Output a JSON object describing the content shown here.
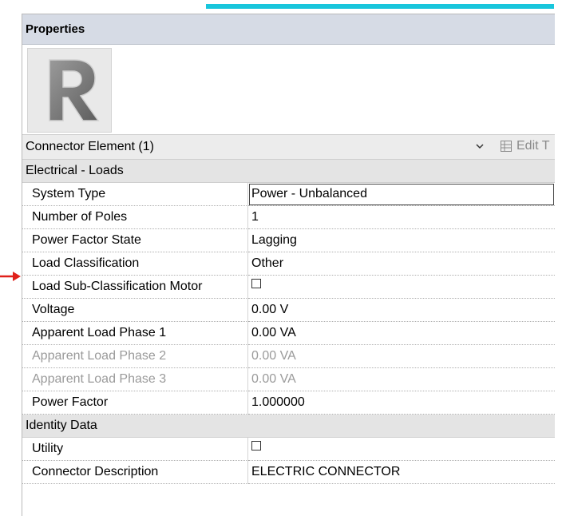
{
  "panel": {
    "title": "Properties",
    "accent_color": "#18c6dc",
    "thumbnail_icon": "revit-logo-icon",
    "type_selector": {
      "selected": "Connector Element (1)",
      "edit_type_label": "Edit T"
    }
  },
  "groups": [
    {
      "label": "Electrical - Loads",
      "rows": [
        {
          "name": "System Type",
          "value": "Power - Unbalanced",
          "kind": "text",
          "active": true
        },
        {
          "name": "Number of Poles",
          "value": "1",
          "kind": "text"
        },
        {
          "name": "Power Factor State",
          "value": "Lagging",
          "kind": "text"
        },
        {
          "name": "Load Classification",
          "value": "Other",
          "kind": "text"
        },
        {
          "name": "Load Sub-Classification Motor",
          "value": "",
          "kind": "checkbox",
          "checked": false
        },
        {
          "name": "Voltage",
          "value": "0.00 V",
          "kind": "text"
        },
        {
          "name": "Apparent Load Phase 1",
          "value": "0.00 VA",
          "kind": "text"
        },
        {
          "name": "Apparent Load Phase 2",
          "value": "0.00 VA",
          "kind": "text",
          "disabled": true
        },
        {
          "name": "Apparent Load Phase 3",
          "value": "0.00 VA",
          "kind": "text",
          "disabled": true
        },
        {
          "name": "Power Factor",
          "value": "1.000000",
          "kind": "text"
        }
      ]
    },
    {
      "label": "Identity Data",
      "rows": [
        {
          "name": "Utility",
          "value": "",
          "kind": "checkbox",
          "checked": false
        },
        {
          "name": "Connector Description",
          "value": "ELECTRIC CONNECTOR",
          "kind": "text"
        }
      ]
    }
  ],
  "annotation": {
    "icon": "red-arrow-icon",
    "color": "#e0201a"
  }
}
